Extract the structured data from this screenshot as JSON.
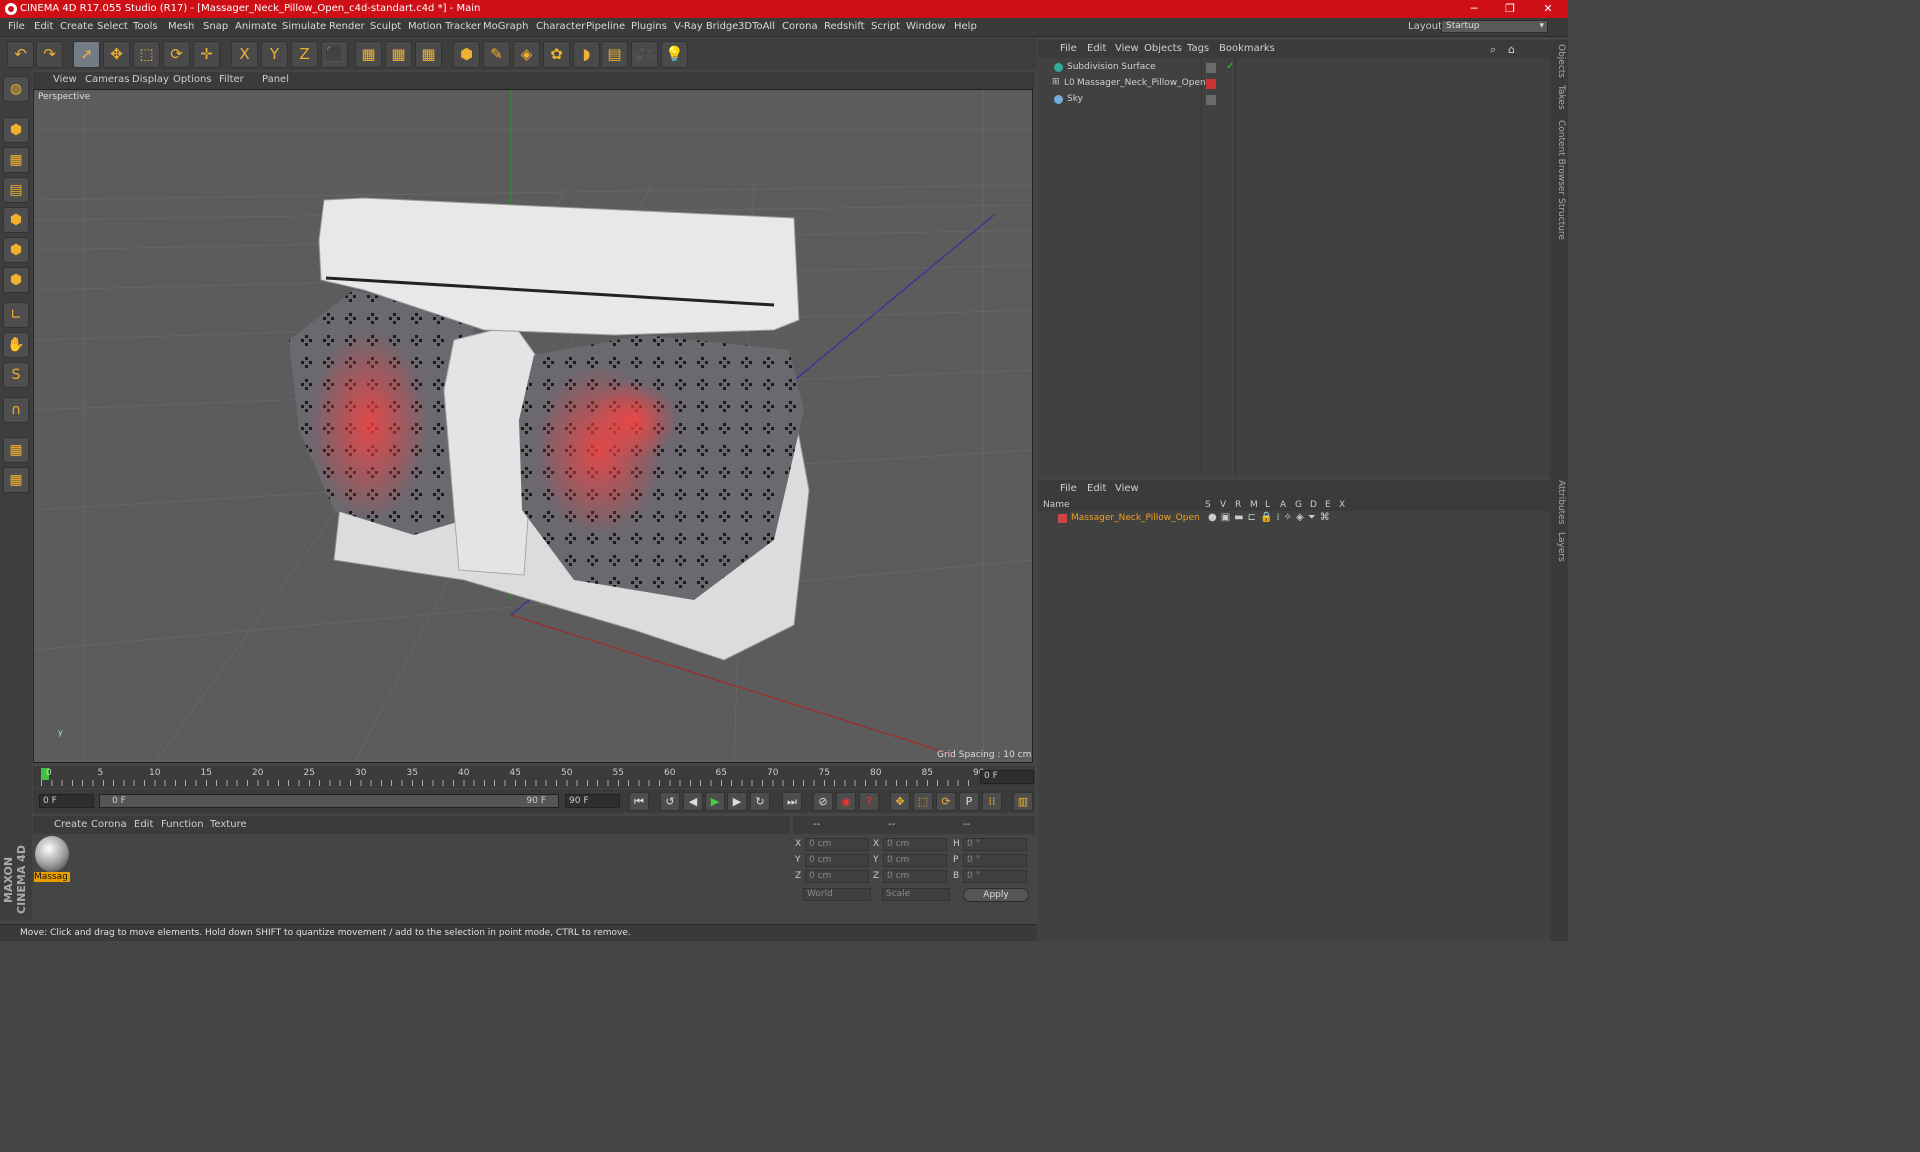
{
  "window": {
    "title": "CINEMA 4D R17.055 Studio (R17) - [Massager_Neck_Pillow_Open_c4d-standart.c4d *] - Main",
    "minimize": "─",
    "restore": "❐",
    "close": "✕"
  },
  "menu": [
    "File",
    "Edit",
    "Create",
    "Select",
    "Tools",
    "Mesh",
    "Snap",
    "Animate",
    "Simulate",
    "Render",
    "Sculpt",
    "Motion Tracker",
    "MoGraph",
    "Character",
    "Pipeline",
    "Plugins",
    "V-Ray Bridge",
    "3DToAll",
    "Corona",
    "Redshift",
    "Script",
    "Window",
    "Help"
  ],
  "layout": {
    "label": "Layout:",
    "value": "Startup"
  },
  "toolbar": [
    {
      "name": "undo-icon",
      "glyph": "↶"
    },
    {
      "name": "redo-icon",
      "glyph": "↷"
    },
    {
      "name": "live-selection-icon",
      "glyph": "➚",
      "sel": true
    },
    {
      "name": "move-icon",
      "glyph": "✥"
    },
    {
      "name": "scale-icon",
      "glyph": "⬚"
    },
    {
      "name": "rotate-icon",
      "glyph": "⟳"
    },
    {
      "name": "transform-icon",
      "glyph": "✛"
    },
    {
      "name": "x-axis-icon",
      "glyph": "X"
    },
    {
      "name": "y-axis-icon",
      "glyph": "Y"
    },
    {
      "name": "z-axis-icon",
      "glyph": "Z"
    },
    {
      "name": "coordinate-system-icon",
      "glyph": "⬛"
    },
    {
      "name": "render-view-icon",
      "glyph": "▦"
    },
    {
      "name": "render-picture-viewer-icon",
      "glyph": "▦"
    },
    {
      "name": "edit-render-settings-icon",
      "glyph": "▦"
    },
    {
      "name": "cube-icon",
      "glyph": "⬢"
    },
    {
      "name": "pen-spline-icon",
      "glyph": "✎"
    },
    {
      "name": "subdivision-icon",
      "glyph": "◈"
    },
    {
      "name": "cloner-icon",
      "glyph": "✿"
    },
    {
      "name": "deformer-icon",
      "glyph": "◗"
    },
    {
      "name": "floor-icon",
      "glyph": "▤"
    },
    {
      "name": "camera-icon",
      "glyph": "🎥"
    },
    {
      "name": "light-icon",
      "glyph": "💡"
    }
  ],
  "lefttools": [
    "make-editable-icon",
    "model-mode-icon",
    "texture-mode-icon",
    "workplane-icon",
    "points-mode-icon",
    "edges-mode-icon",
    "polygons-mode-icon",
    "axis-mode-icon",
    "tweak-icon",
    "snap-icon",
    "magnet-icon",
    "lock-grid-icon",
    "solo-grid-icon"
  ],
  "viewport": {
    "menu": [
      "View",
      "Cameras",
      "Display",
      "Options",
      "Filter",
      "Panel"
    ],
    "label": "Perspective",
    "grid": "Grid Spacing : 10 cm"
  },
  "timeline": {
    "ticks": [
      "0",
      "5",
      "10",
      "15",
      "20",
      "25",
      "30",
      "35",
      "40",
      "45",
      "50",
      "55",
      "60",
      "65",
      "70",
      "75",
      "80",
      "85",
      "90"
    ],
    "current": "0 F"
  },
  "transport": {
    "start": "0 F",
    "range_start": "0 F",
    "range_end": "90 F",
    "end": "90 F"
  },
  "material": {
    "menu": [
      "Create",
      "Corona",
      "Edit",
      "Function",
      "Texture"
    ],
    "name": "Massag"
  },
  "coords": {
    "head": [
      "--",
      "--",
      "--"
    ],
    "rows": [
      [
        "X",
        "0 cm",
        "X",
        "0 cm",
        "H",
        "0 °"
      ],
      [
        "Y",
        "0 cm",
        "Y",
        "0 cm",
        "P",
        "0 °"
      ],
      [
        "Z",
        "0 cm",
        "Z",
        "0 cm",
        "B",
        "0 °"
      ]
    ],
    "world": "World",
    "scale": "Scale",
    "apply": "Apply"
  },
  "status": "Move: Click and drag to move elements. Hold down SHIFT to quantize movement / add to the selection in point mode, CTRL to remove.",
  "brand": "MAXON CINEMA 4D",
  "objects": {
    "menu": [
      "File",
      "Edit",
      "View",
      "Objects",
      "Tags",
      "Bookmarks"
    ],
    "items": [
      "Subdivision Surface",
      "Massager_Neck_Pillow_Open",
      "Sky"
    ]
  },
  "layers": {
    "menu": [
      "File",
      "Edit",
      "View"
    ],
    "cols": [
      "Name",
      "S",
      "V",
      "R",
      "M",
      "L",
      "A",
      "G",
      "D",
      "E",
      "X"
    ],
    "item": "Massager_Neck_Pillow_Open"
  },
  "sidetabs": [
    "Objects",
    "Takes",
    "Content Browser",
    "Structure",
    "Attributes",
    "Layers"
  ]
}
